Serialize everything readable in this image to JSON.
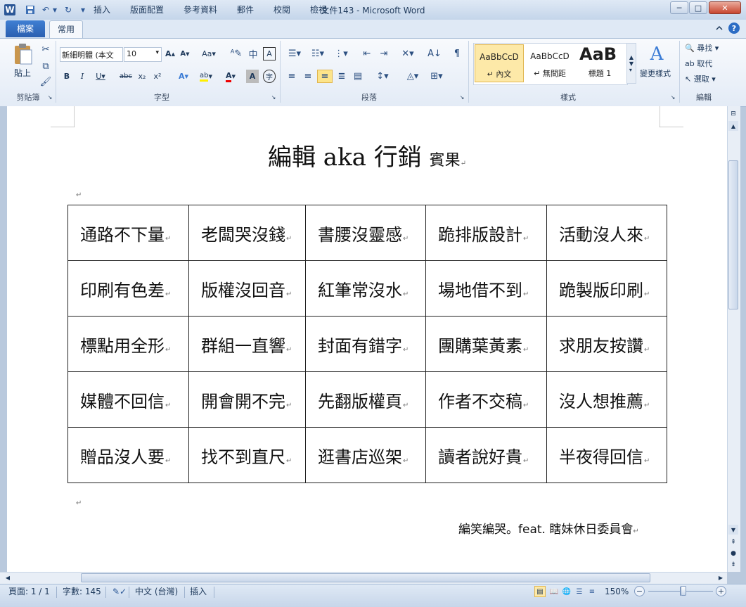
{
  "window": {
    "title": "文件143 - Microsoft Word",
    "minimize": "─",
    "maximize": "□",
    "close": "✕"
  },
  "quick_access": {
    "app_icon": "W",
    "save": "💾",
    "undo": "↶",
    "redo": "↻",
    "customize": "▾"
  },
  "tabs": [
    {
      "label": "檔案"
    },
    {
      "label": "常用"
    },
    {
      "label": "插入"
    },
    {
      "label": "版面配置"
    },
    {
      "label": "參考資料"
    },
    {
      "label": "郵件"
    },
    {
      "label": "校閱"
    },
    {
      "label": "檢視"
    }
  ],
  "ribbon": {
    "clipboard": {
      "paste": "貼上",
      "label": "剪貼簿"
    },
    "font": {
      "name": "新細明體 (本文",
      "size": "10",
      "aa": "Aa",
      "label": "字型"
    },
    "paragraph": {
      "label": "段落"
    },
    "styles": {
      "items": [
        {
          "preview": "AaBbCcD",
          "name": "↵ 內文"
        },
        {
          "preview": "AaBbCcD",
          "name": "↵ 無間距"
        },
        {
          "preview": "AaB",
          "name": "標題 1"
        }
      ],
      "change": "變更樣式",
      "label": "樣式"
    },
    "editing": {
      "find": "尋找",
      "replace": "取代",
      "select": "選取",
      "label": "編輯"
    }
  },
  "document": {
    "title": "編輯 aka 行銷",
    "subtitle": "賓果",
    "grid": [
      [
        "通路不下量",
        "老闆哭沒錢",
        "書腰沒靈感",
        "跪排版設計",
        "活動沒人來"
      ],
      [
        "印刷有色差",
        "版權沒回音",
        "紅筆常沒水",
        "場地借不到",
        "跪製版印刷"
      ],
      [
        "標點用全形",
        "群組一直響",
        "封面有錯字",
        "團購葉黃素",
        "求朋友按讚"
      ],
      [
        "媒體不回信",
        "開會開不完",
        "先翻版權頁",
        "作者不交稿",
        "沒人想推薦"
      ],
      [
        "贈品沒人要",
        "找不到直尺",
        "逛書店巡架",
        "讀者說好貴",
        "半夜得回信"
      ]
    ],
    "footer_note": "編笑編哭。feat. 瞎妹休日委員會",
    "para_mark": "↵"
  },
  "statusbar": {
    "page": "頁面: 1 / 1",
    "words": "字數: 145",
    "language": "中文 (台灣)",
    "mode": "插入",
    "zoom": "150%"
  },
  "colors": {
    "accent": "#2a5fb0",
    "ribbon_bg": "#e3ebf6",
    "window_frame": "#b9c9dd"
  }
}
